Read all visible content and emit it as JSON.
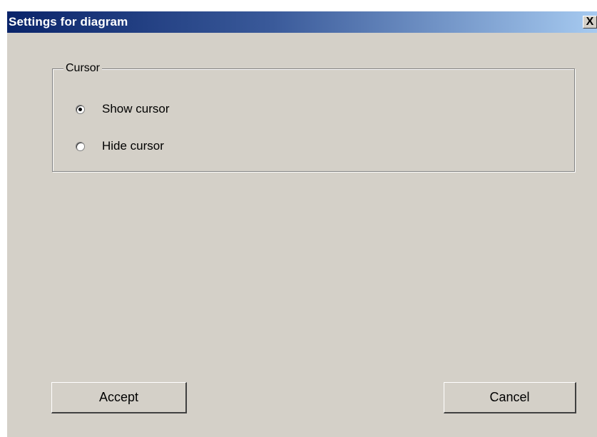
{
  "window": {
    "title": "Settings for diagram",
    "close_glyph": "X"
  },
  "cursor_group": {
    "label": "Cursor",
    "options": [
      {
        "label": "Show cursor",
        "selected": true
      },
      {
        "label": "Hide cursor",
        "selected": false
      }
    ]
  },
  "buttons": {
    "accept": "Accept",
    "cancel": "Cancel"
  },
  "colors": {
    "titlebar_start": "#0a246a",
    "titlebar_end": "#a6caf0",
    "window_bg": "#d4d0c8"
  }
}
